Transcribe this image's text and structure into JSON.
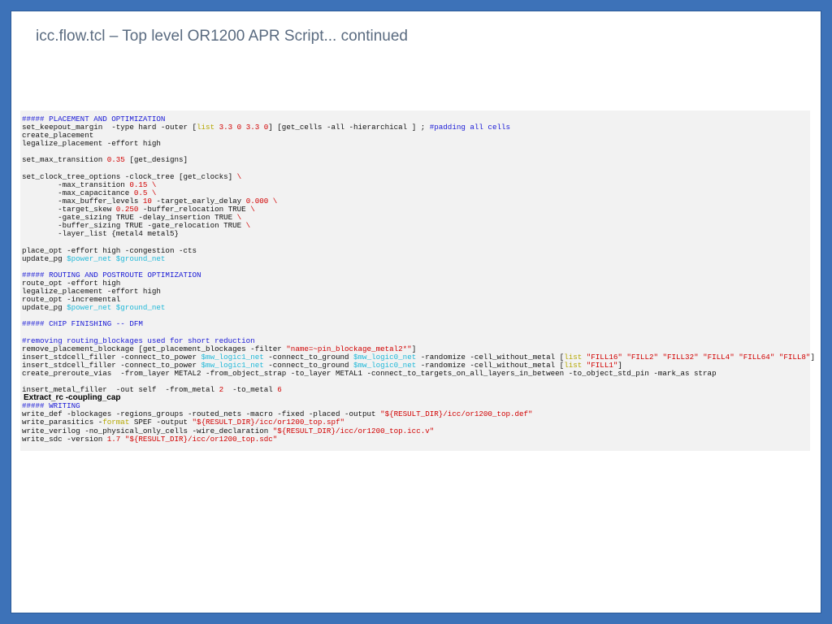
{
  "slide": {
    "title": "icc.flow.tcl – Top level OR1200 APR Script... continued"
  },
  "colors": {
    "frame": "#3d72b8",
    "title": "#5a6b80",
    "comment": "#1a1ad6",
    "number": "#d10000",
    "keyword": "#b5a700",
    "variable": "#20b8d8",
    "panel_bg": "#f2f2f2"
  },
  "code_lines": [
    [
      {
        "t": "##### PLACEMENT AND OPTIMIZATION",
        "c": "com"
      }
    ],
    [
      {
        "t": "set_keepout_margin  -type hard -outer [",
        "c": "txt"
      },
      {
        "t": "list",
        "c": "kw"
      },
      {
        "t": " ",
        "c": "txt"
      },
      {
        "t": "3.3 0 3.3 0",
        "c": "num"
      },
      {
        "t": "] [get_cells -all -hierarchical ] ; ",
        "c": "txt"
      },
      {
        "t": "#padding all cells",
        "c": "com"
      }
    ],
    [
      {
        "t": "create_placement",
        "c": "txt"
      }
    ],
    [
      {
        "t": "legalize_placement -effort high",
        "c": "txt"
      }
    ],
    [],
    [
      {
        "t": "set_max_transition ",
        "c": "txt"
      },
      {
        "t": "0.35",
        "c": "num"
      },
      {
        "t": " [get_designs]",
        "c": "txt"
      }
    ],
    [],
    [
      {
        "t": "set_clock_tree_options -clock_tree [get_clocks] ",
        "c": "txt"
      },
      {
        "t": "\\",
        "c": "bs"
      }
    ],
    [
      {
        "t": "        -max_transition ",
        "c": "txt"
      },
      {
        "t": "0.15",
        "c": "num"
      },
      {
        "t": " ",
        "c": "txt"
      },
      {
        "t": "\\",
        "c": "bs"
      }
    ],
    [
      {
        "t": "        -max_capacitance ",
        "c": "txt"
      },
      {
        "t": "0.5",
        "c": "num"
      },
      {
        "t": " ",
        "c": "txt"
      },
      {
        "t": "\\",
        "c": "bs"
      }
    ],
    [
      {
        "t": "        -max_buffer_levels ",
        "c": "txt"
      },
      {
        "t": "10",
        "c": "num"
      },
      {
        "t": " -target_early_delay ",
        "c": "txt"
      },
      {
        "t": "0.000",
        "c": "num"
      },
      {
        "t": " ",
        "c": "txt"
      },
      {
        "t": "\\",
        "c": "bs"
      }
    ],
    [
      {
        "t": "        -target_skew ",
        "c": "txt"
      },
      {
        "t": "0.250",
        "c": "num"
      },
      {
        "t": " -buffer_relocation TRUE ",
        "c": "txt"
      },
      {
        "t": "\\",
        "c": "bs"
      }
    ],
    [
      {
        "t": "        -gate_sizing TRUE -delay_insertion TRUE ",
        "c": "txt"
      },
      {
        "t": "\\",
        "c": "bs"
      }
    ],
    [
      {
        "t": "        -buffer_sizing TRUE -gate_relocation TRUE ",
        "c": "txt"
      },
      {
        "t": "\\",
        "c": "bs"
      }
    ],
    [
      {
        "t": "        -layer_list {metal4 metal5}",
        "c": "txt"
      }
    ],
    [],
    [
      {
        "t": "place_opt -effort high -congestion -cts",
        "c": "txt"
      }
    ],
    [
      {
        "t": "update_pg ",
        "c": "txt"
      },
      {
        "t": "$power_net",
        "c": "var"
      },
      {
        "t": " ",
        "c": "txt"
      },
      {
        "t": "$ground_net",
        "c": "var"
      }
    ],
    [],
    [
      {
        "t": "##### ROUTING AND POSTROUTE OPTIMIZATION",
        "c": "com"
      }
    ],
    [
      {
        "t": "route_opt -effort high",
        "c": "txt"
      }
    ],
    [
      {
        "t": "legalize_placement -effort high",
        "c": "txt"
      }
    ],
    [
      {
        "t": "route_opt -incremental",
        "c": "txt"
      }
    ],
    [
      {
        "t": "update_pg ",
        "c": "txt"
      },
      {
        "t": "$power_net",
        "c": "var"
      },
      {
        "t": " ",
        "c": "txt"
      },
      {
        "t": "$ground_net",
        "c": "var"
      }
    ],
    [],
    [
      {
        "t": "##### CHIP FINISHING -- DFM",
        "c": "com"
      }
    ],
    [],
    [
      {
        "t": "#removing routing_blockages used for short reduction",
        "c": "com"
      }
    ],
    [
      {
        "t": "remove_placement_blockage [get_placement_blockages -filter ",
        "c": "txt"
      },
      {
        "t": "\"name=~pin_blockage_metal2*\"",
        "c": "str"
      },
      {
        "t": "]",
        "c": "txt"
      }
    ],
    [
      {
        "t": "insert_stdcell_filler -connect_to_power ",
        "c": "txt"
      },
      {
        "t": "$mw_logic1_net",
        "c": "var"
      },
      {
        "t": " -connect_to_ground ",
        "c": "txt"
      },
      {
        "t": "$mw_logic0_net",
        "c": "var"
      },
      {
        "t": " -randomize -cell_without_metal [",
        "c": "txt"
      },
      {
        "t": "list",
        "c": "kw"
      },
      {
        "t": " ",
        "c": "txt"
      },
      {
        "t": "\"FILL16\" \"FILL2\" \"FILL32\" \"FILL4\" \"FILL64\" \"FILL8\"",
        "c": "str"
      },
      {
        "t": "]",
        "c": "txt"
      }
    ],
    [
      {
        "t": "insert_stdcell_filler -connect_to_power ",
        "c": "txt"
      },
      {
        "t": "$mw_logic1_net",
        "c": "var"
      },
      {
        "t": " -connect_to_ground ",
        "c": "txt"
      },
      {
        "t": "$mw_logic0_net",
        "c": "var"
      },
      {
        "t": " -randomize -cell_without_metal [",
        "c": "txt"
      },
      {
        "t": "list",
        "c": "kw"
      },
      {
        "t": " ",
        "c": "txt"
      },
      {
        "t": "\"FILL1\"",
        "c": "str"
      },
      {
        "t": "]",
        "c": "txt"
      }
    ],
    [
      {
        "t": "create_preroute_vias  -from_layer METAL2 -from_object_strap -to_layer METAL1 -connect_to_targets_on_all_layers_in_between -to_object_std_pin -mark_as strap",
        "c": "txt"
      }
    ],
    [],
    [
      {
        "t": "insert_metal_filler  -out self  -from_metal ",
        "c": "txt"
      },
      {
        "t": "2",
        "c": "num"
      },
      {
        "t": "  -to_metal ",
        "c": "txt"
      },
      {
        "t": "6",
        "c": "num"
      }
    ],
    [
      {
        "t": "Extract_rc -coupling_cap",
        "c": "extract"
      }
    ],
    [
      {
        "t": "##### WRITING",
        "c": "com"
      }
    ],
    [
      {
        "t": "write_def -blockages -regions_groups -routed_nets -macro -fixed -placed -output ",
        "c": "txt"
      },
      {
        "t": "\"${RESULT_DIR}/icc/or1200_top.def\"",
        "c": "str"
      }
    ],
    [
      {
        "t": "write_parasitics -",
        "c": "txt"
      },
      {
        "t": "format",
        "c": "kw"
      },
      {
        "t": " SPEF -output ",
        "c": "txt"
      },
      {
        "t": "\"${RESULT_DIR}/icc/or1200_top.spf\"",
        "c": "str"
      }
    ],
    [
      {
        "t": "write_verilog -no_physical_only_cells -wire_declaration ",
        "c": "txt"
      },
      {
        "t": "\"${RESULT_DIR}/icc/or1200_top.icc.v\"",
        "c": "str"
      }
    ],
    [
      {
        "t": "write_sdc -version ",
        "c": "txt"
      },
      {
        "t": "1.7",
        "c": "num"
      },
      {
        "t": " ",
        "c": "txt"
      },
      {
        "t": "\"${RESULT_DIR}/icc/or1200_top.sdc\"",
        "c": "str"
      }
    ]
  ]
}
